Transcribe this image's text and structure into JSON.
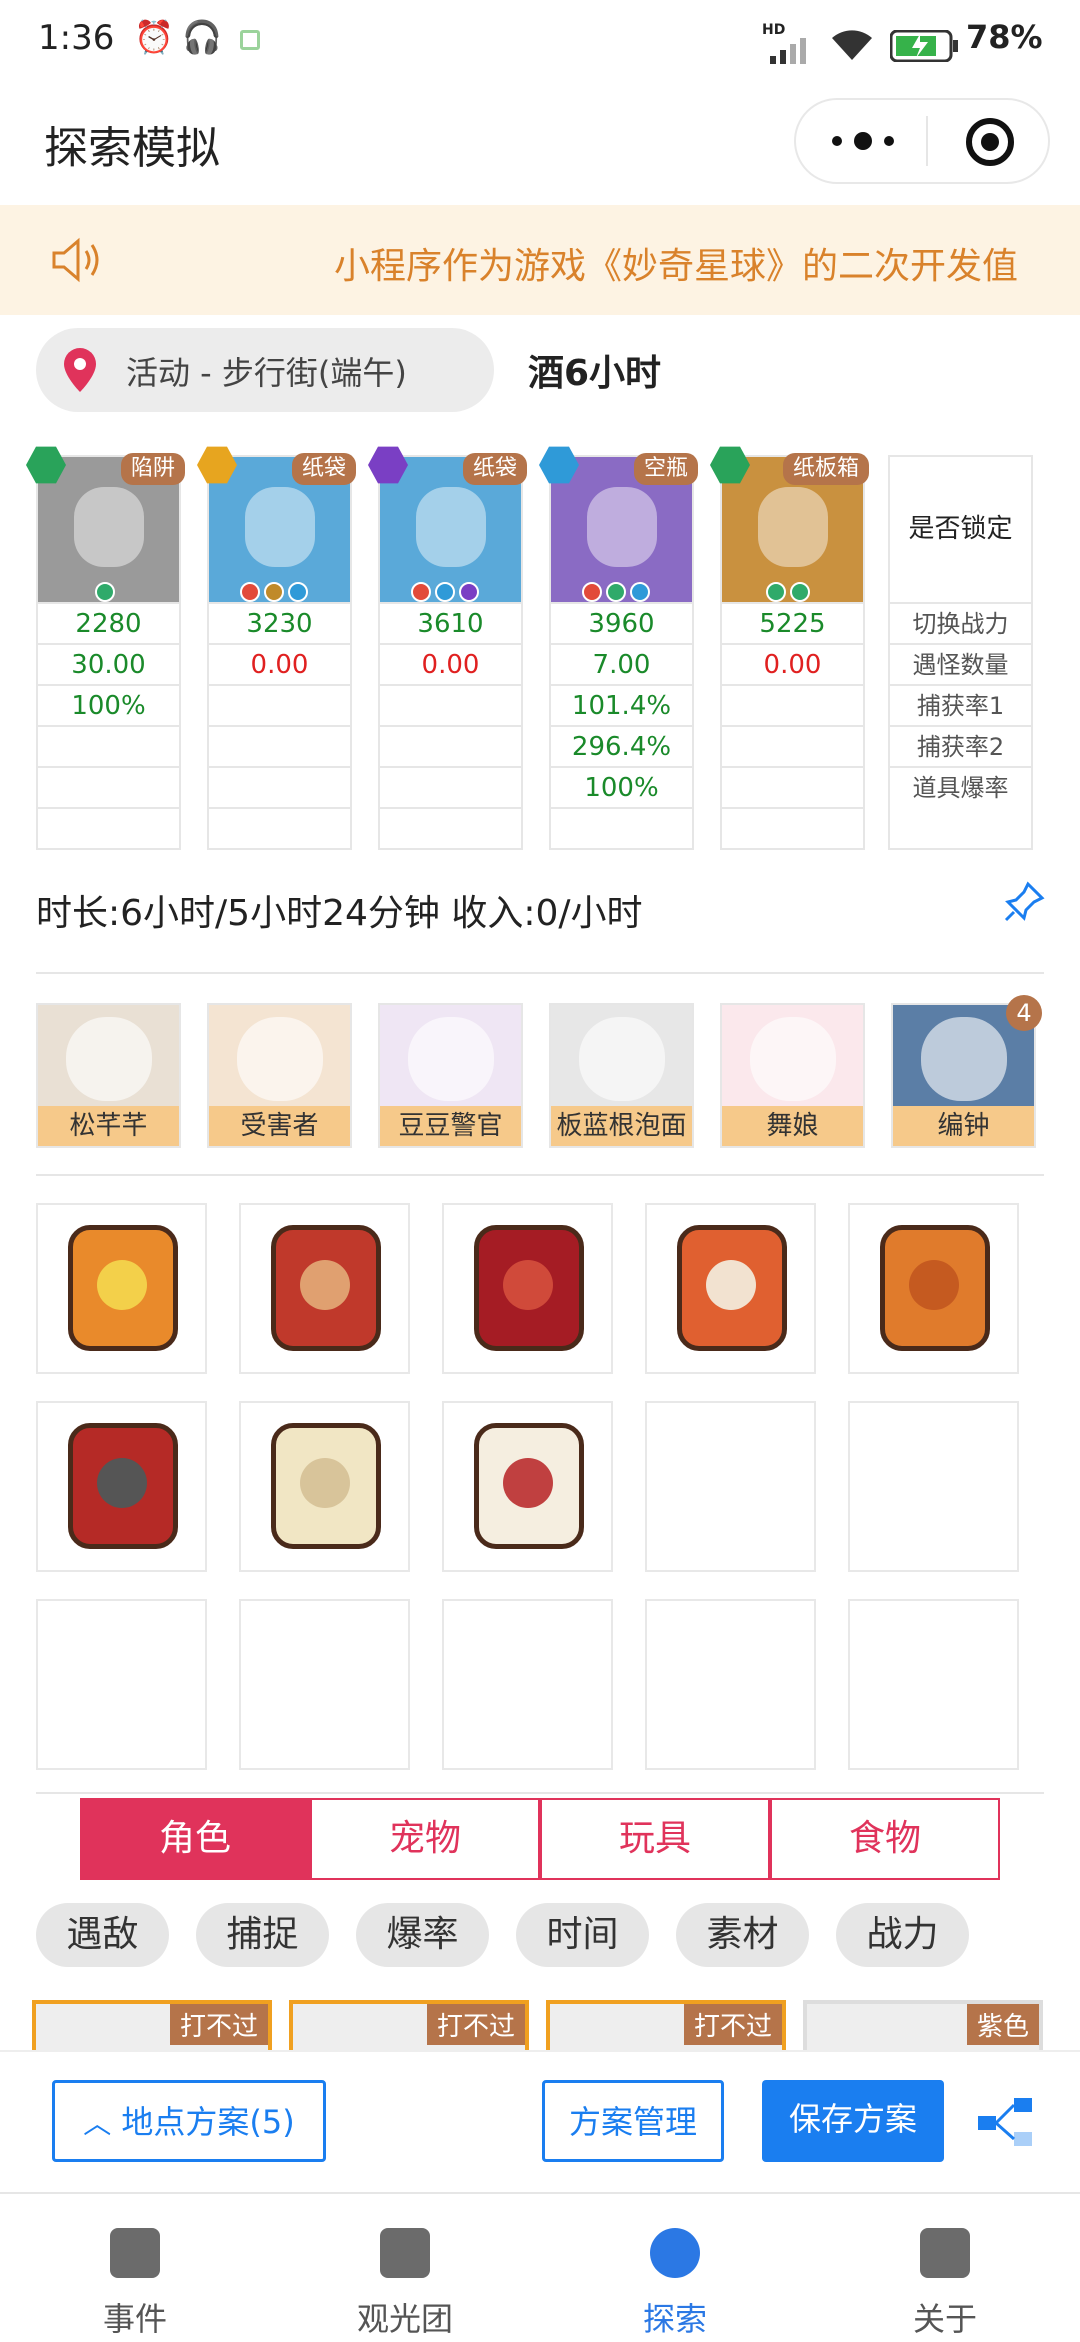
{
  "status": {
    "time": "1:36",
    "network": "HD",
    "battery": "78%"
  },
  "nav": {
    "title": "探索模拟"
  },
  "notice": {
    "text": "小程序作为游戏《妙奇星球》的二次开发值"
  },
  "location": {
    "name": "活动 - 步行街(端午)",
    "item": "酒6小时"
  },
  "monsters": [
    {
      "tag": "陷阱",
      "power": "2280",
      "count": "30.00",
      "rate1": "100%",
      "rate2": "",
      "drop": "",
      "gem": "#29a35a",
      "bg": "#9a9a9a",
      "dots": [
        "#2faa6a"
      ]
    },
    {
      "tag": "纸袋",
      "power": "3230",
      "count": "0.00",
      "rate1": "",
      "rate2": "",
      "drop": "",
      "gem": "#e7a51f",
      "bg": "#5aa9d9",
      "dots": [
        "#e24a3a",
        "#c08a2a",
        "#2f9ad8"
      ]
    },
    {
      "tag": "纸袋",
      "power": "3610",
      "count": "0.00",
      "rate1": "",
      "rate2": "",
      "drop": "",
      "gem": "#7a3fc4",
      "bg": "#5aa9d9",
      "dots": [
        "#e24a3a",
        "#2f9ad8",
        "#7a3fc4"
      ]
    },
    {
      "tag": "空瓶",
      "power": "3960",
      "count": "7.00",
      "rate1": "101.4%",
      "rate2": "296.4%",
      "drop": "100%",
      "gem": "#2f9ad8",
      "bg": "#8a6bc4",
      "dots": [
        "#e24a3a",
        "#2faa6a",
        "#2f9ad8"
      ]
    },
    {
      "tag": "纸板箱",
      "power": "5225",
      "count": "0.00",
      "rate1": "",
      "rate2": "",
      "drop": "",
      "gem": "#29a35a",
      "bg": "#c9913f",
      "dots": [
        "#2faa6a",
        "#2faa6a"
      ]
    }
  ],
  "labels": {
    "lock": "是否锁定",
    "switch": "切换战力",
    "count": "遇怪数量",
    "rate1": "捕获率1",
    "rate2": "捕获率2",
    "drop": "道具爆率"
  },
  "summary": "时长:6小时/5小时24分钟 收入:0/小时",
  "characters": [
    {
      "name": "松芊芊",
      "bg": "#e9e0d4"
    },
    {
      "name": "受害者",
      "bg": "#f4e4d2"
    },
    {
      "name": "豆豆警官",
      "bg": "#efe6f4"
    },
    {
      "name": "板蓝根泡面",
      "bg": "#e7e7e7"
    },
    {
      "name": "舞娘",
      "bg": "#fbe8ec"
    },
    {
      "name": "编钟",
      "bg": "#5b7ea6",
      "badge": "4"
    }
  ],
  "tabs": [
    "角色",
    "宠物",
    "玩具",
    "食物"
  ],
  "chips": [
    "遇敌",
    "捕捉",
    "爆率",
    "时间",
    "素材",
    "战力"
  ],
  "cards": [
    {
      "label": "打不过"
    },
    {
      "label": "打不过"
    },
    {
      "label": "打不过"
    },
    {
      "label": "紫色"
    }
  ],
  "actions": {
    "plan": "地点方案(5)",
    "manage": "方案管理",
    "save": "保存方案"
  },
  "tabbar": [
    {
      "label": "事件"
    },
    {
      "label": "观光团"
    },
    {
      "label": "探索"
    },
    {
      "label": "关于"
    }
  ],
  "colors": {
    "accent": "#e0335b",
    "blue": "#1a7ef0",
    "green": "#1a8a2a",
    "red": "#e02020"
  }
}
